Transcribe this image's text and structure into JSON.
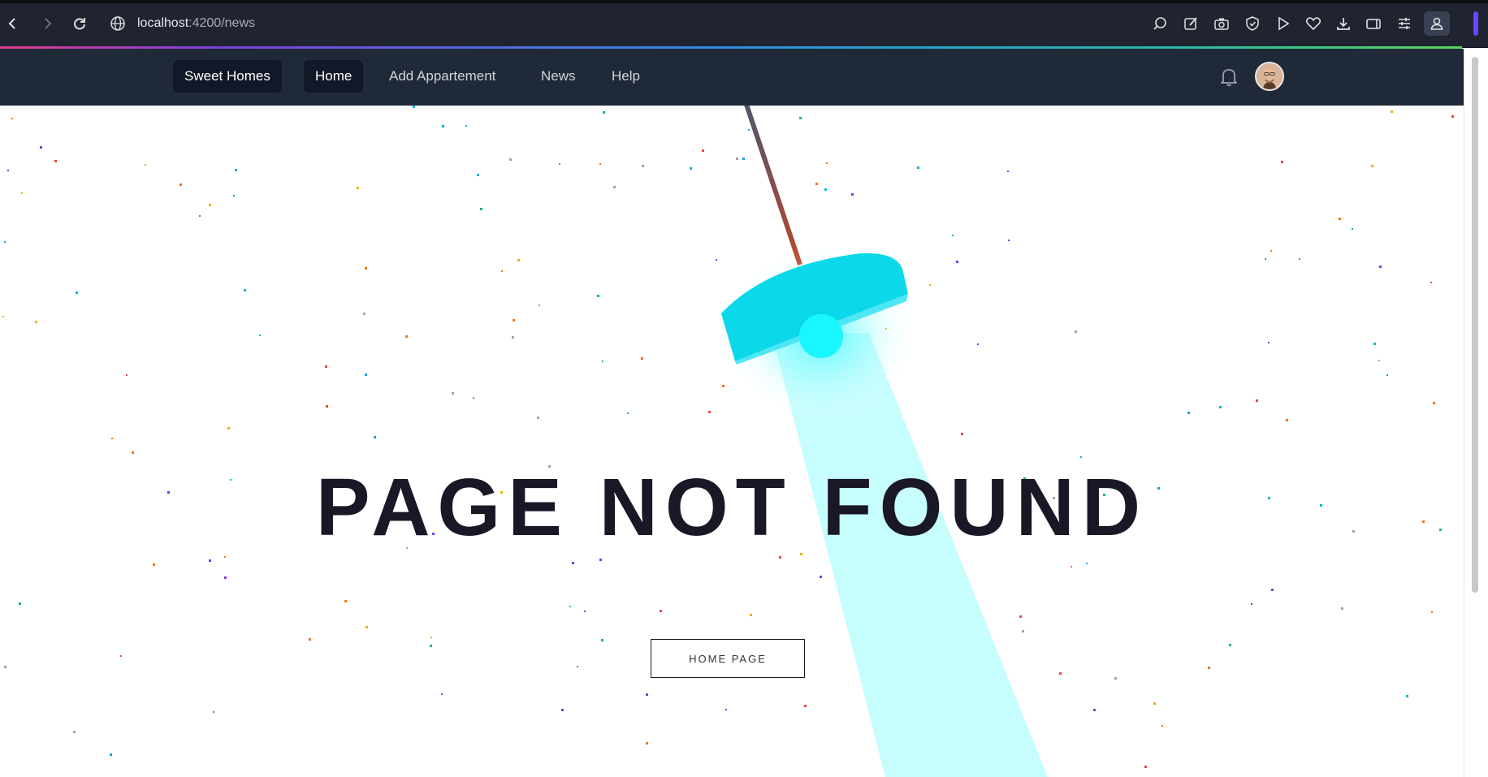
{
  "browser": {
    "url_host": "localhost",
    "url_path": ":4200/news",
    "toolbar_icons": [
      "search-tab-icon",
      "edit-icon",
      "camera-icon",
      "shield-icon",
      "play-icon",
      "heart-icon",
      "download-icon",
      "wallet-icon",
      "settings-sliders-icon",
      "profile-icon"
    ]
  },
  "navbar": {
    "brand": "Sweet Homes",
    "links": [
      {
        "label": "Home",
        "active": true
      },
      {
        "label": "Add Appartement",
        "active": false
      },
      {
        "label": "News",
        "active": false
      },
      {
        "label": "Help",
        "active": false
      }
    ],
    "icons": [
      "bell-icon",
      "avatar"
    ]
  },
  "main": {
    "headline": "PAGE NOT FOUND",
    "home_button": "HOME PAGE"
  },
  "colors": {
    "navbar_bg": "#1f2937",
    "lamp": "#0bd8e8",
    "beam": "#c6fdfd",
    "headline": "#1a1826"
  }
}
